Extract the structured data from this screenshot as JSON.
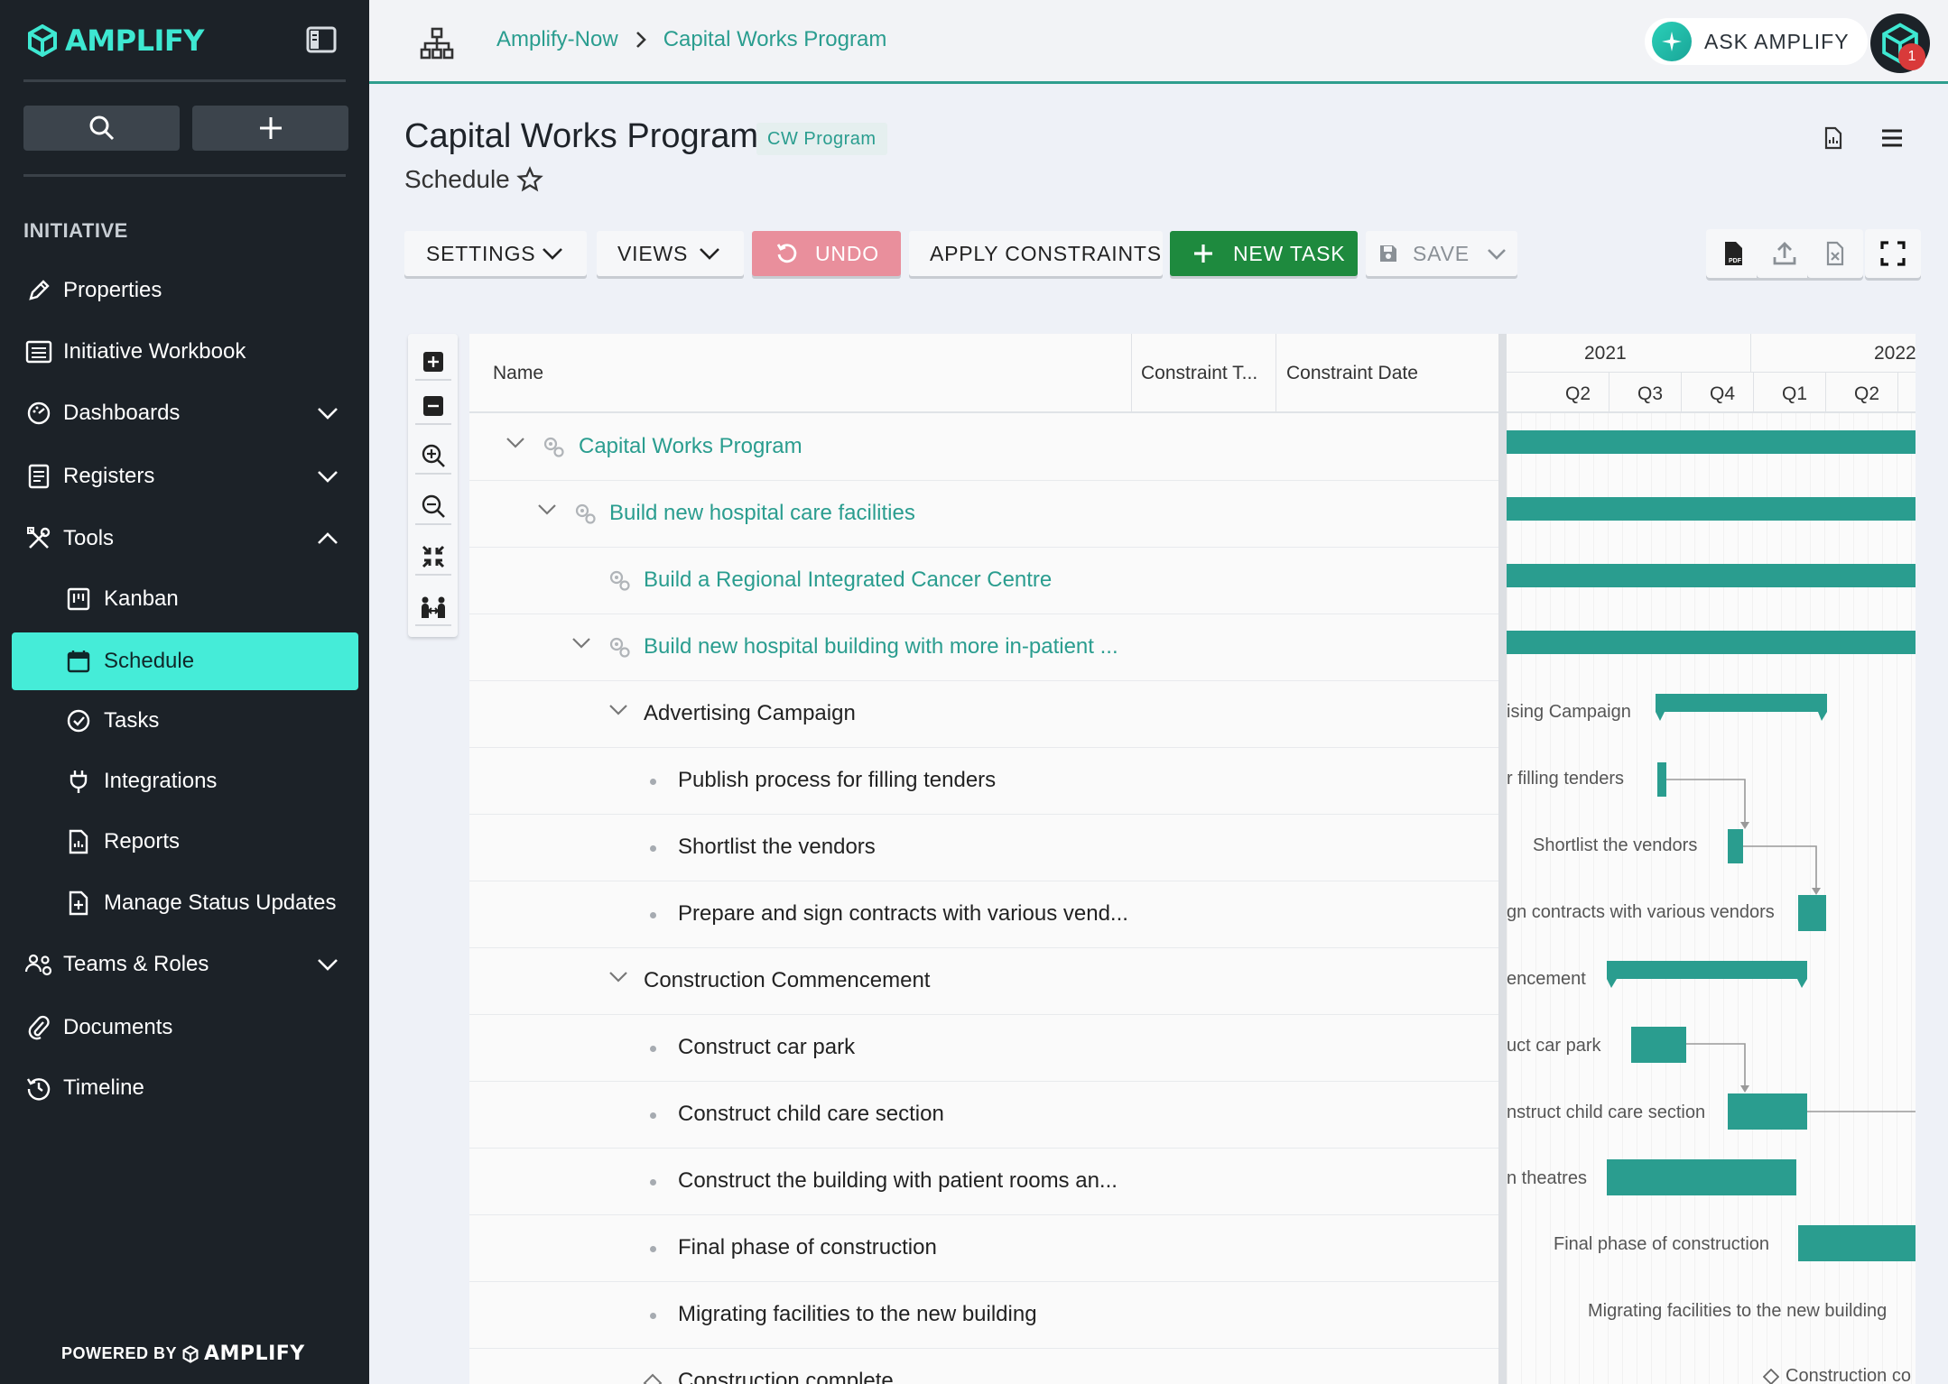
{
  "app": {
    "name": "AMPLIFY",
    "powered_by": "POWERED BY",
    "powered_brand": "AMPLIFY"
  },
  "sidebar": {
    "section": "INITIATIVE",
    "items": [
      {
        "label": "Properties",
        "icon": "pencil-icon"
      },
      {
        "label": "Initiative Workbook",
        "icon": "list-icon"
      },
      {
        "label": "Dashboards",
        "icon": "dashboard-icon"
      },
      {
        "label": "Registers",
        "icon": "register-icon"
      },
      {
        "label": "Tools",
        "icon": "tools-icon"
      },
      {
        "label": "Kanban",
        "icon": "kanban-icon"
      },
      {
        "label": "Schedule",
        "icon": "calendar-icon",
        "active": true
      },
      {
        "label": "Tasks",
        "icon": "check-circle-icon"
      },
      {
        "label": "Integrations",
        "icon": "plug-icon"
      },
      {
        "label": "Reports",
        "icon": "report-icon"
      },
      {
        "label": "Manage Status Updates",
        "icon": "status-file-icon"
      },
      {
        "label": "Teams & Roles",
        "icon": "team-icon"
      },
      {
        "label": "Documents",
        "icon": "paperclip-icon"
      },
      {
        "label": "Timeline",
        "icon": "history-icon"
      }
    ]
  },
  "topbar": {
    "breadcrumbs": [
      "Amplify-Now",
      "Capital Works Program"
    ],
    "ask_label": "ASK AMPLIFY",
    "notification_count": "1"
  },
  "page": {
    "title": "Capital Works Program",
    "tag": "CW Program",
    "subtitle": "Schedule"
  },
  "toolbar": {
    "settings": "SETTINGS",
    "views": "VIEWS",
    "undo": "UNDO",
    "apply_constraints": "APPLY CONSTRAINTS",
    "new_task": "NEW TASK",
    "save": "SAVE"
  },
  "grid": {
    "columns": [
      "Name",
      "Constraint T...",
      "Constraint Date"
    ],
    "rows": [
      {
        "name": "Capital Works Program"
      },
      {
        "name": "Build new hospital care facilities"
      },
      {
        "name": "Build a Regional Integrated Cancer Centre"
      },
      {
        "name": "Build new hospital building with more in-patient ..."
      },
      {
        "name": "Advertising Campaign"
      },
      {
        "name": "Publish process for filling tenders"
      },
      {
        "name": "Shortlist the vendors"
      },
      {
        "name": "Prepare and sign contracts with various vend..."
      },
      {
        "name": "Construction Commencement"
      },
      {
        "name": "Construct car park"
      },
      {
        "name": "Construct child care section"
      },
      {
        "name": "Construct the building with patient rooms an..."
      },
      {
        "name": "Final phase of construction"
      },
      {
        "name": "Migrating facilities to the new building"
      },
      {
        "name": "Construction complete"
      }
    ]
  },
  "gantt": {
    "years": [
      "2021",
      "2022"
    ],
    "quarters": [
      "Q2",
      "Q3",
      "Q4",
      "Q1",
      "Q2"
    ],
    "labels": [
      "ising Campaign",
      "r filling tenders",
      "Shortlist the vendors",
      "gn contracts with various vendors",
      "encement",
      "uct car park",
      "nstruct child care section",
      "n theatres",
      "Final phase of construction",
      "Migrating facilities to the new building",
      "Construction co"
    ]
  }
}
